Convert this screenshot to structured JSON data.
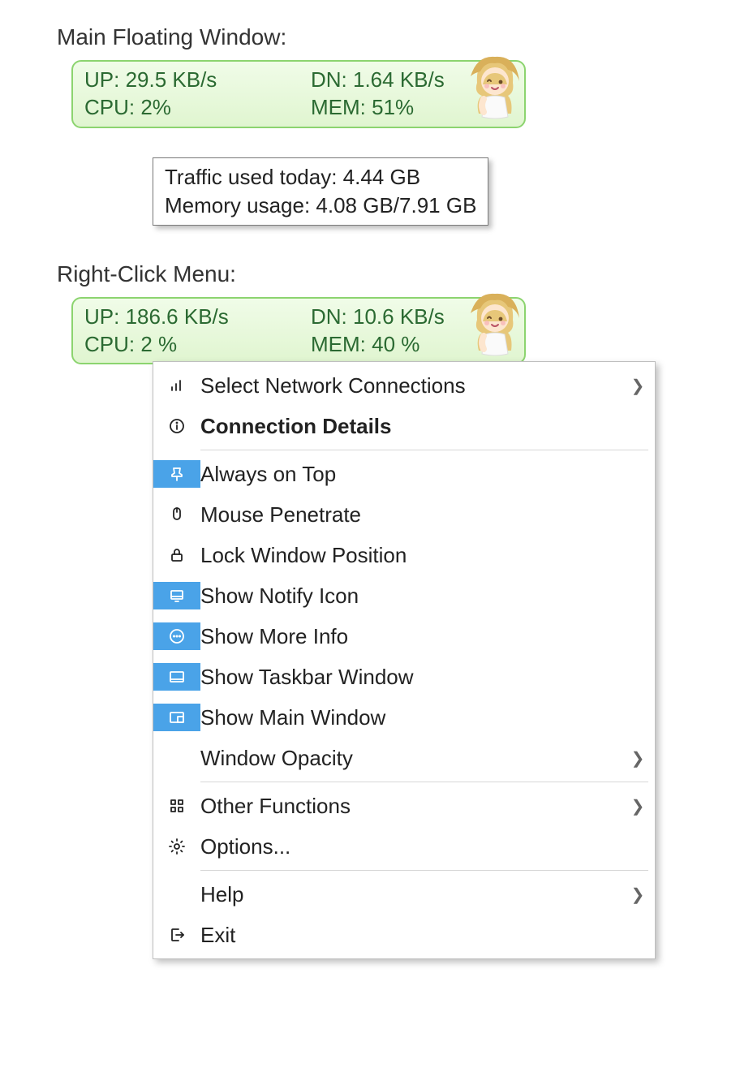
{
  "sections": {
    "main_floating_window": "Main Floating Window:",
    "right_click_menu": "Right-Click Menu:"
  },
  "widget1": {
    "up": "UP: 29.5 KB/s",
    "dn": "DN: 1.64 KB/s",
    "cpu": "CPU: 2%",
    "mem": "MEM: 51%"
  },
  "tooltip": {
    "line1": "Traffic used today: 4.44 GB",
    "line2": "Memory usage: 4.08 GB/7.91 GB"
  },
  "widget2": {
    "up": "UP: 186.6 KB/s",
    "dn": "DN: 10.6 KB/s",
    "cpu": "CPU: 2 %",
    "mem": "MEM: 40 %"
  },
  "menu": {
    "select_network": "Select Network Connections",
    "connection_details": "Connection Details",
    "always_on_top": "Always on Top",
    "mouse_penetrate": "Mouse Penetrate",
    "lock_window_position": "Lock Window Position",
    "show_notify_icon": "Show Notify Icon",
    "show_more_info": "Show More Info",
    "show_taskbar_window": "Show Taskbar Window",
    "show_main_window": "Show Main Window",
    "window_opacity": "Window Opacity",
    "other_functions": "Other Functions",
    "options": "Options...",
    "help": "Help",
    "exit": "Exit"
  }
}
